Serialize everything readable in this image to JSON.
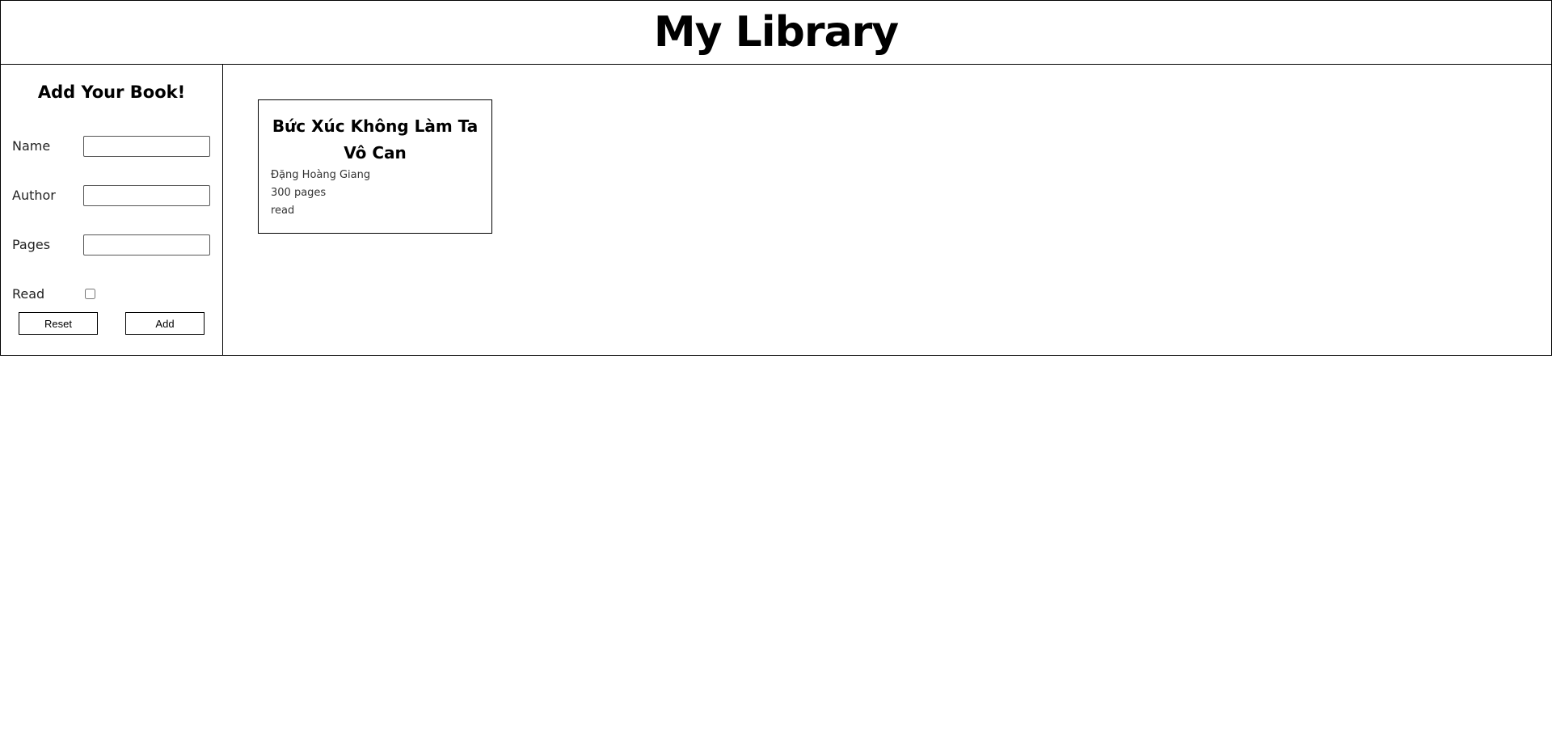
{
  "header": {
    "title": "My Library"
  },
  "form": {
    "heading": "Add Your Book!",
    "fields": {
      "name": {
        "label": "Name",
        "value": "",
        "placeholder": ""
      },
      "author": {
        "label": "Author",
        "value": "",
        "placeholder": ""
      },
      "pages": {
        "label": "Pages",
        "value": "",
        "placeholder": ""
      },
      "read": {
        "label": "Read",
        "checked": false
      }
    },
    "reset_label": "Reset",
    "add_label": "Add"
  },
  "books": [
    {
      "title": "Bức Xúc Không Làm Ta Vô Can",
      "author": "Đặng Hoàng Giang",
      "pages": "300 pages",
      "status": "read"
    }
  ]
}
